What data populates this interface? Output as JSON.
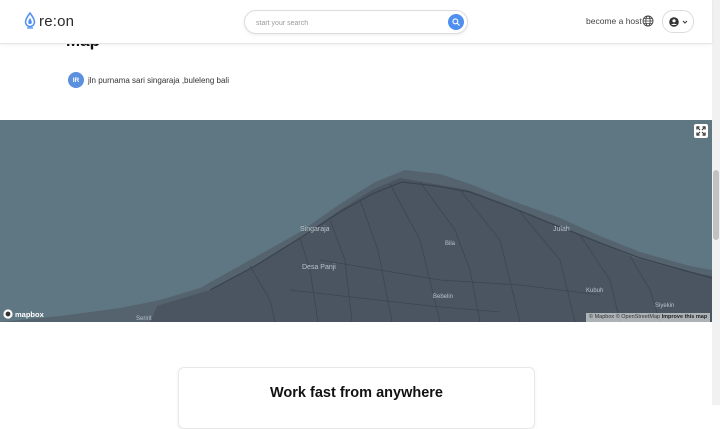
{
  "header": {
    "logo_text": "re:on",
    "search_placeholder": "start your search",
    "host_link": "become a host"
  },
  "section": {
    "title": "Map",
    "address_badge": "IR",
    "address": "jln purnama sari singaraja ,buleleng bali"
  },
  "map": {
    "labels": {
      "singaraja": "Singaraja",
      "desa_panji": "Desa Panji",
      "bila": "Bila",
      "julah": "Julah",
      "bebelin": "Bebelin",
      "kubuh": "Kubuh",
      "siyekin": "Siyekin",
      "seririt": "Seririt"
    },
    "provider_logo": "mapbox",
    "attribution": {
      "mapbox": "© Mapbox",
      "osm": "© OpenStreetMap",
      "improve": "Improve this map"
    },
    "colors": {
      "sea": "#5f7782",
      "land": "#4a5561",
      "road": "#3a4550"
    }
  },
  "card": {
    "title": "Work fast from anywhere"
  },
  "colors": {
    "accent": "#4e8ff0"
  }
}
